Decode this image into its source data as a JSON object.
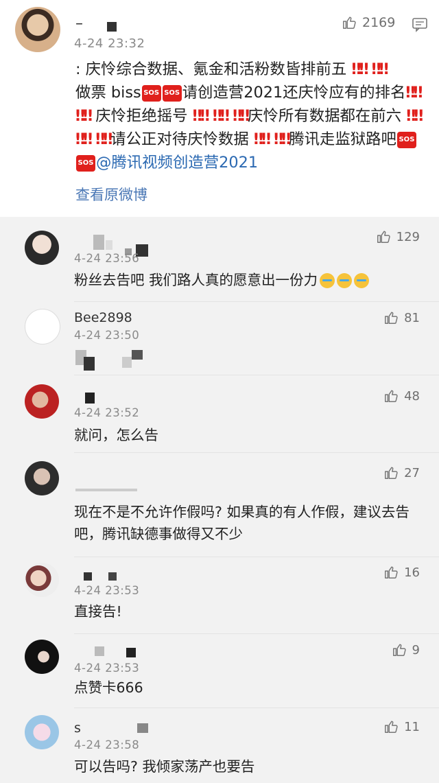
{
  "post": {
    "username": "–",
    "time": "4-24 23:32",
    "like_count": "2169",
    "text_parts": [
      ": 庆怜综合数据、氪金和活粉数皆排前五",
      "做票 biss",
      "请创造营2021还庆怜应有的排名",
      " 庆怜拒绝摇号",
      "庆怜所有数据都在前六",
      "请公正对待庆怜数据",
      "腾讯走监狱路吧"
    ],
    "mention": "@腾讯视频创造营2021",
    "original_link": "查看原微博"
  },
  "comments": [
    {
      "name": "",
      "time": "4-24 23:56",
      "text": "粉丝去告吧 我们路人真的愿意出一份力",
      "likes": "129"
    },
    {
      "name": "Bee2898",
      "time": "4-24 23:50",
      "text": "",
      "likes": "81"
    },
    {
      "name": "",
      "time": "4-24 23:52",
      "text": "就问，怎么告",
      "likes": "48"
    },
    {
      "name": "",
      "time": "",
      "text": "现在不是不允许作假吗? 如果真的有人作假，建议去告吧，腾讯缺德事做得又不少",
      "likes": "27"
    },
    {
      "name": "",
      "time": "4-24 23:53",
      "text": "直接告!",
      "likes": "16"
    },
    {
      "name": "",
      "time": "4-24 23:53",
      "text": "点赞卡666",
      "likes": "9"
    },
    {
      "name": "s",
      "time": "4-24 23:58",
      "text": "可以告吗? 我倾家荡产也要告",
      "likes": "11"
    }
  ],
  "icons": {
    "like": "thumbs-up-icon",
    "comment": "comment-icon",
    "sos": "sos-icon",
    "bang": "double-exclamation-icon",
    "cry": "crying-face-icon"
  },
  "colors": {
    "link": "#4a77b5",
    "mention": "#2b69b2",
    "emoji_red": "#e0201c",
    "meta_gray": "#8a8a8a"
  },
  "emoji": {
    "bang": "‼‼",
    "sos": "SOS"
  }
}
